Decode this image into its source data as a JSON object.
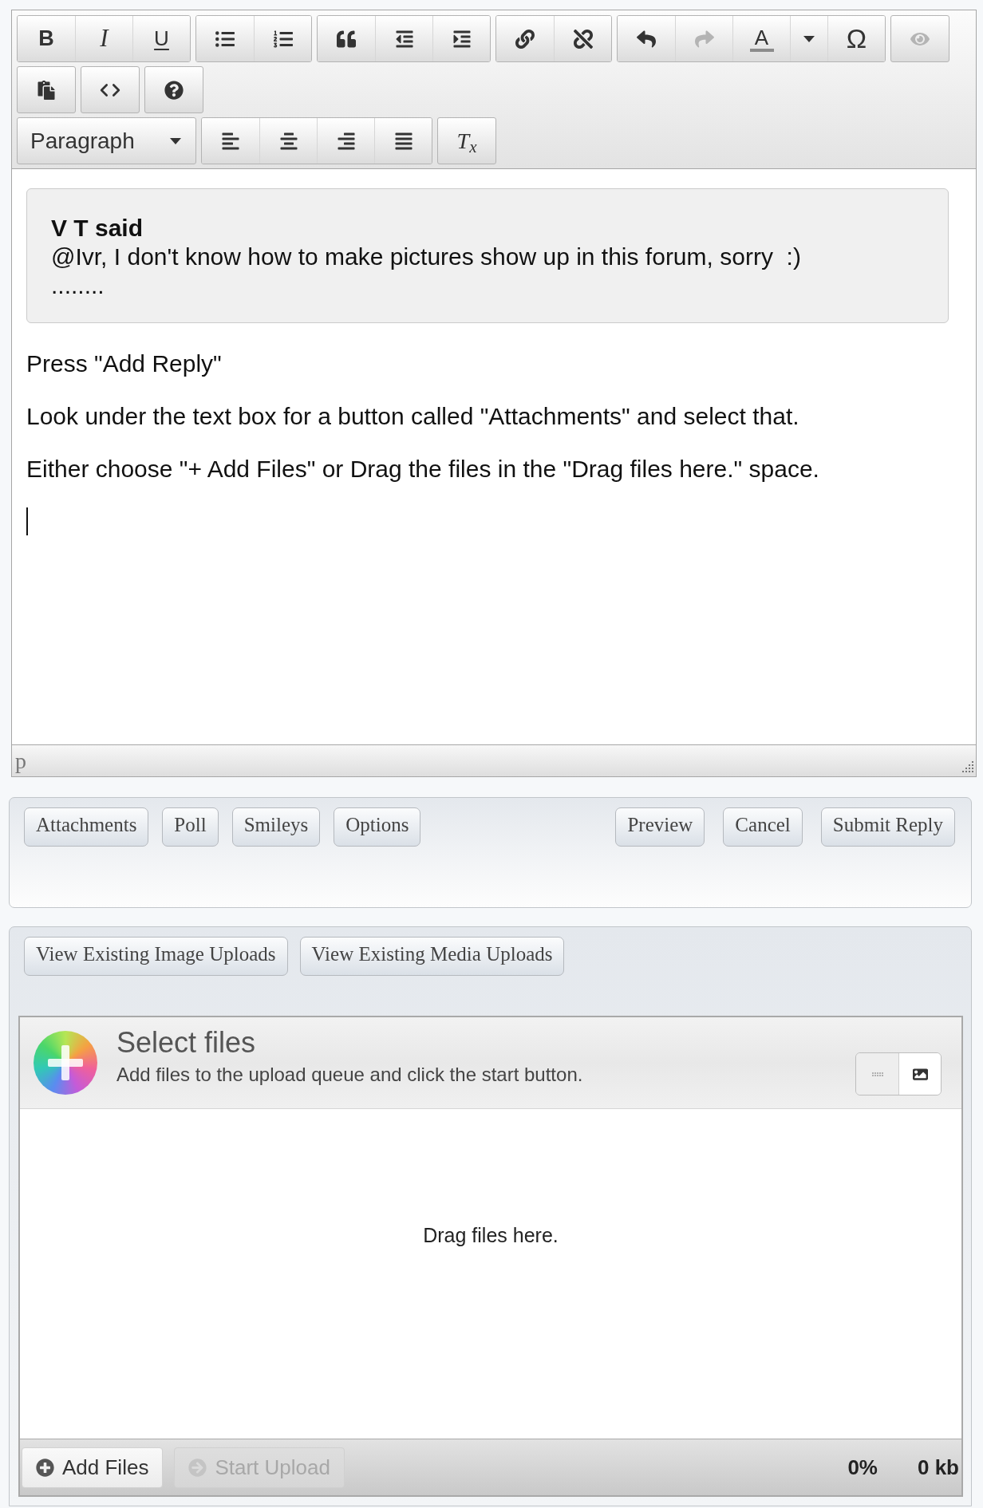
{
  "toolbar": {
    "rows": [
      [
        {
          "buttons": [
            {
              "kind": "text",
              "label": "B",
              "disabled": false
            },
            {
              "kind": "text",
              "label": "I",
              "disabled": false
            },
            {
              "kind": "text",
              "label": "U",
              "disabled": false
            }
          ]
        },
        {
          "buttons": [
            {
              "kind": "icon",
              "disabled": false
            },
            {
              "kind": "icon",
              "disabled": false
            }
          ]
        },
        {
          "buttons": [
            {
              "kind": "icon",
              "disabled": false
            },
            {
              "kind": "icon",
              "disabled": false
            },
            {
              "kind": "icon",
              "disabled": false
            }
          ]
        },
        {
          "buttons": [
            {
              "kind": "icon",
              "disabled": false
            },
            {
              "kind": "icon",
              "disabled": false
            }
          ]
        },
        {
          "buttons": [
            {
              "kind": "icon",
              "disabled": false
            },
            {
              "kind": "icon",
              "disabled": true
            },
            {
              "kind": "text",
              "label": "A",
              "disabled": false
            },
            {
              "kind": "icon",
              "disabled": false
            },
            {
              "kind": "text",
              "label": "Ω",
              "disabled": false
            }
          ]
        },
        {
          "buttons": [
            {
              "kind": "icon",
              "disabled": true
            }
          ]
        }
      ],
      [
        {
          "buttons": [
            {
              "kind": "icon",
              "disabled": false
            }
          ]
        },
        {
          "buttons": [
            {
              "kind": "icon",
              "disabled": false
            }
          ]
        },
        {
          "buttons": [
            {
              "kind": "icon",
              "disabled": false
            }
          ]
        }
      ],
      [
        {
          "buttons": [
            {
              "kind": "dropdown",
              "label": "Paragraph",
              "disabled": false
            }
          ]
        },
        {
          "buttons": [
            {
              "kind": "icon",
              "disabled": false
            },
            {
              "kind": "icon",
              "disabled": false
            },
            {
              "kind": "icon",
              "disabled": false
            },
            {
              "kind": "icon",
              "disabled": false
            }
          ]
        },
        {
          "buttons": [
            {
              "kind": "text",
              "label": "T$_{x}$",
              "disabled": false
            }
          ]
        }
      ]
    ]
  },
  "editor": {
    "quote": {
      "author": "V T said",
      "lines": [
        "@Ivr, I don't know how to make pictures show up in this forum, sorry  :)",
        "........"
      ]
    },
    "paragraphs": [
      "Press \"Add Reply\"",
      "Look under the text box for a button called \"Attachments\" and select that.",
      "Either choose \"+ Add Files\" or Drag the files in the \"Drag files here.\" space."
    ],
    "status_path": "p"
  },
  "actions": {
    "left": [
      "Attachments",
      "Poll",
      "Smileys",
      "Options"
    ],
    "right": [
      "Preview",
      "Cancel",
      "Submit Reply"
    ]
  },
  "uploads": {
    "buttons": [
      "View Existing Image Uploads",
      "View Existing Media Uploads"
    ],
    "uploader": {
      "title": "Select files",
      "subtitle": "Add files to the upload queue and click the start button.",
      "view_modes": [
        {
          "selected": false
        },
        {
          "selected": true
        }
      ],
      "drop_hint": "Drag files here.",
      "add_button": {
        "label": "Add Files",
        "disabled": false
      },
      "start_button": {
        "label": "Start Upload",
        "disabled": true
      },
      "percent": "0%",
      "size": "0 kb"
    }
  }
}
